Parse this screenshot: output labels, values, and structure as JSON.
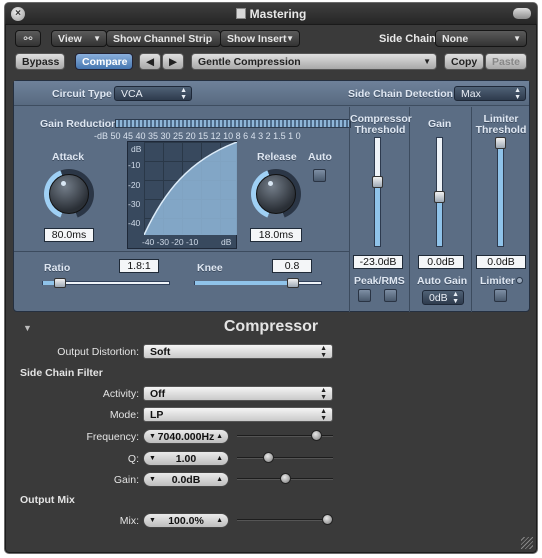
{
  "window": {
    "title": "Mastering"
  },
  "toolbar1": {
    "view_label": "View",
    "channel_strip_label": "Show Channel Strip",
    "insert_label": "Show Insert",
    "side_chain_label": "Side Chain:",
    "side_chain_value": "None"
  },
  "toolbar2": {
    "bypass_label": "Bypass",
    "compare_label": "Compare",
    "prev_glyph": "◀",
    "next_glyph": "▶",
    "preset_value": "Gentle Compression",
    "copy_label": "Copy",
    "paste_label": "Paste"
  },
  "plugin": {
    "circuit_type_label": "Circuit Type",
    "circuit_type_value": "VCA",
    "side_chain_detection_label": "Side Chain Detection",
    "side_chain_detection_value": "Max",
    "gain_reduction_label": "Gain Reduction",
    "meter_scale": "-dB 50 45 40 35 30 25 20 15 12 10  8  6  4  3  2  1.5  1  0",
    "attack_label": "Attack",
    "attack_value": "80.0ms",
    "release_label": "Release",
    "release_value": "18.0ms",
    "auto_label": "Auto",
    "graph": {
      "y_unit": "dB",
      "y_ticks": [
        "-10",
        "-20",
        "-30",
        "-40"
      ],
      "x_ticks": "-40 -30 -20 -10",
      "x_unit": "dB"
    },
    "ratio_label": "Ratio",
    "ratio_value": "1.8:1",
    "ratio_fraction": 0.1,
    "knee_label": "Knee",
    "knee_value": "0.8",
    "knee_fraction": 0.8,
    "compressor_threshold_label": "Compressor Threshold",
    "compressor_threshold_value": "-23.0dB",
    "compressor_threshold_fraction": 0.6,
    "gain_label": "Gain",
    "gain_value": "0.0dB",
    "gain_fraction": 0.45,
    "limiter_threshold_label": "Limiter Threshold",
    "limiter_threshold_value": "0.0dB",
    "limiter_threshold_fraction": 1.0,
    "peak_rms_label": "Peak/RMS",
    "auto_gain_label": "Auto Gain",
    "auto_gain_value": "0dB",
    "limiter_label": "Limiter"
  },
  "extended": {
    "title": "Compressor",
    "output_distortion_label": "Output Distortion:",
    "output_distortion_value": "Soft",
    "side_chain_filter_label": "Side Chain Filter",
    "activity_label": "Activity:",
    "activity_value": "Off",
    "mode_label": "Mode:",
    "mode_value": "LP",
    "frequency_label": "Frequency:",
    "frequency_value": "7040.000Hz",
    "frequency_fraction": 0.87,
    "q_label": "Q:",
    "q_value": "1.00",
    "q_fraction": 0.3,
    "gain_label": "Gain:",
    "gain_value": "0.0dB",
    "gain_fraction": 0.5,
    "output_mix_label": "Output Mix",
    "mix_label": "Mix:",
    "mix_value": "100.0%",
    "mix_fraction": 1.0
  }
}
